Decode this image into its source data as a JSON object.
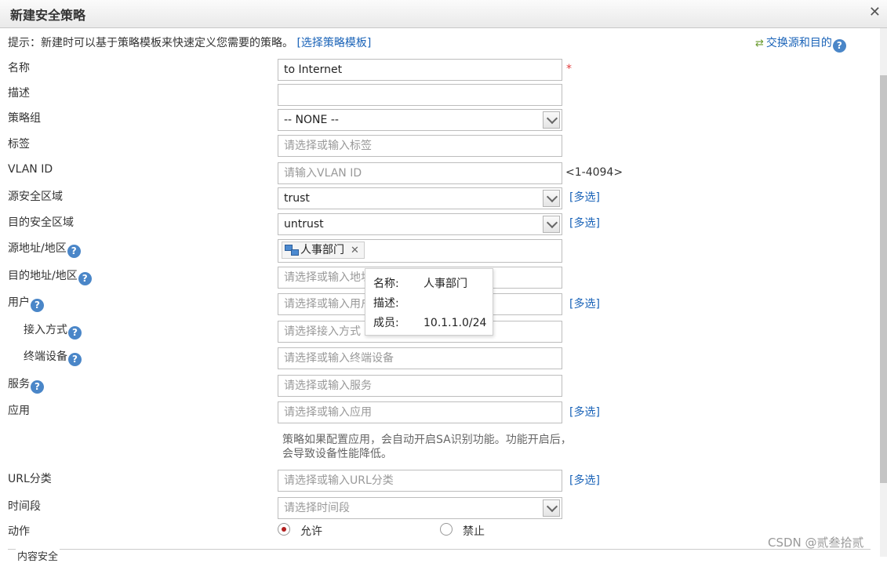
{
  "dialog": {
    "title": "新建安全策略"
  },
  "tip": {
    "text": "提示：新建时可以基于策略模板来快速定义您需要的策略。",
    "link": "[选择策略模板]"
  },
  "swap_label": "交换源和目的",
  "fields": {
    "name": {
      "label": "名称",
      "value": "to Internet",
      "required": "*"
    },
    "desc": {
      "label": "描述",
      "value": ""
    },
    "group": {
      "label": "策略组",
      "value": "-- NONE --"
    },
    "tag": {
      "label": "标签",
      "placeholder": "请选择或输入标签"
    },
    "vlan": {
      "label": "VLAN ID",
      "placeholder": "请输入VLAN ID",
      "hint": "<1-4094>"
    },
    "src_zone": {
      "label": "源安全区域",
      "value": "trust",
      "multi": "[多选]"
    },
    "dst_zone": {
      "label": "目的安全区域",
      "value": "untrust",
      "multi": "[多选]"
    },
    "src_addr": {
      "label": "源地址/地区",
      "tag": "人事部门"
    },
    "dst_addr": {
      "label": "目的地址/地区",
      "placeholder": "请选择或输入地址"
    },
    "user": {
      "label": "用户",
      "placeholder": "请选择或输入用户",
      "multi": "[多选]"
    },
    "access": {
      "label": "接入方式",
      "placeholder": "请选择接入方式"
    },
    "terminal": {
      "label": "终端设备",
      "placeholder": "请选择或输入终端设备"
    },
    "service": {
      "label": "服务",
      "placeholder": "请选择或输入服务"
    },
    "app": {
      "label": "应用",
      "placeholder": "请选择或输入应用",
      "multi": "[多选]",
      "note": "策略如果配置应用，会自动开启SA识别功能。功能开启后，会导致设备性能降低。"
    },
    "url": {
      "label": "URL分类",
      "placeholder": "请选择或输入URL分类",
      "multi": "[多选]"
    },
    "time": {
      "label": "时间段",
      "placeholder": "请选择时间段"
    },
    "action": {
      "label": "动作",
      "allow": "允许",
      "deny": "禁止",
      "selected": "允许"
    }
  },
  "tooltip": {
    "name_key": "名称:",
    "name_val": "人事部门",
    "desc_key": "描述:",
    "desc_val": "",
    "member_key": "成员:",
    "member_val": "10.1.1.0/24"
  },
  "section_label": "内容安全",
  "watermark": "CSDN @贰叁拾贰",
  "colors": {
    "link": "#1a63b8",
    "required": "#e23c3c",
    "radio_selected": "#b22020"
  }
}
